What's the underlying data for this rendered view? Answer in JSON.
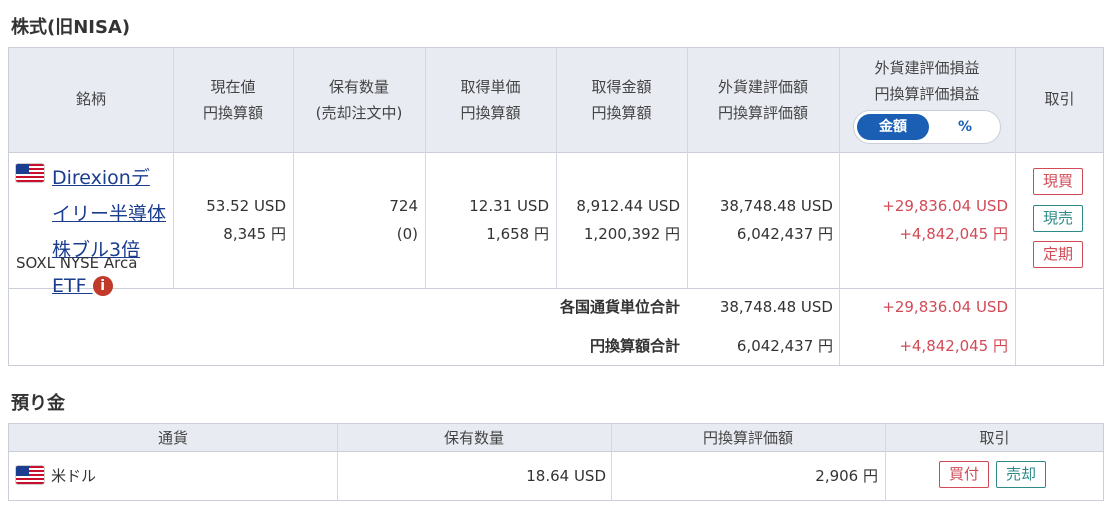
{
  "sections": {
    "stocks_title": "株式(旧NISA)",
    "deposit_title": "預り金"
  },
  "holdings_table": {
    "headers": {
      "name": "銘柄",
      "price_l1": "現在値",
      "price_l2": "円換算額",
      "qty_l1": "保有数量",
      "qty_l2": "(売却注文中)",
      "unit_l1": "取得単価",
      "unit_l2": "円換算額",
      "cost_l1": "取得金額",
      "cost_l2": "円換算額",
      "val_l1": "外貨建評価額",
      "val_l2": "円換算評価額",
      "pl_l1": "外貨建評価損益",
      "pl_l2": "円換算評価損益",
      "trade": "取引"
    },
    "toggle": {
      "amount": "金額",
      "percent": "%"
    },
    "row": {
      "name": "Direxionデイリー半導体株ブル3倍ETF",
      "info_icon": "i",
      "ticker": "SOXL NYSE Arca",
      "price_usd": "53.52 USD",
      "price_jpy": "8,345 円",
      "qty": "724",
      "qty_selling": "(0)",
      "unit_usd": "12.31 USD",
      "unit_jpy": "1,658 円",
      "cost_usd": "8,912.44 USD",
      "cost_jpy": "1,200,392 円",
      "val_usd": "38,748.48 USD",
      "val_jpy": "6,042,437 円",
      "pl_usd": "+29,836.04 USD",
      "pl_jpy": "+4,842,045 円",
      "btn_spot_buy": "現買",
      "btn_spot_sell": "現売",
      "btn_regular": "定期"
    },
    "totals": {
      "currency_label": "各国通貨単位合計",
      "currency_val": "38,748.48 USD",
      "currency_pl": "+29,836.04 USD",
      "jpy_label": "円換算額合計",
      "jpy_val": "6,042,437 円",
      "jpy_pl": "+4,842,045 円"
    }
  },
  "deposit_table": {
    "headers": {
      "currency": "通貨",
      "qty": "保有数量",
      "jpy_value": "円換算評価額",
      "trade": "取引"
    },
    "row": {
      "currency": "米ドル",
      "qty": "18.64 USD",
      "jpy_value": "2,906 円",
      "btn_buy": "買付",
      "btn_sell": "売却"
    }
  },
  "colors": {
    "accent_blue": "#1a5fb4",
    "profit_red": "#d14b57",
    "sell_teal": "#2d8a87",
    "header_bg": "#e8ebf2"
  },
  "icons": [
    "us-flag-icon",
    "info-icon"
  ]
}
